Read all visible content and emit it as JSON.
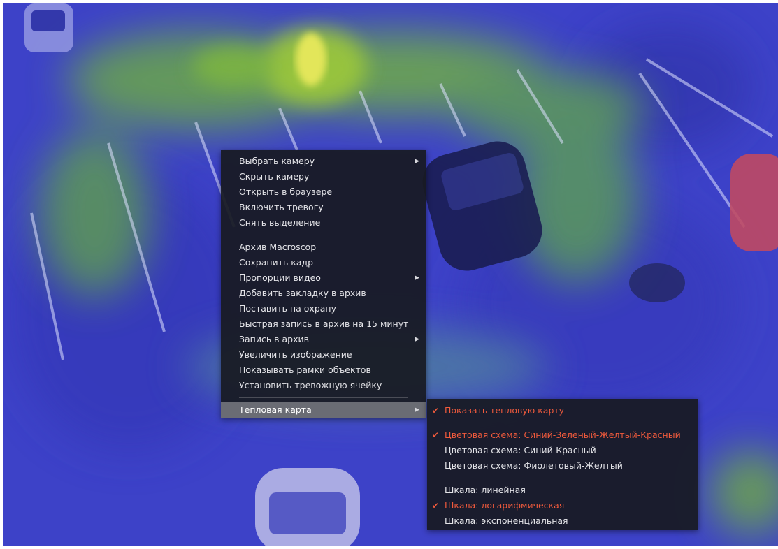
{
  "main_menu": {
    "groups": [
      [
        {
          "label": "Выбрать камеру",
          "submenu": true
        },
        {
          "label": "Скрыть камеру",
          "submenu": false
        },
        {
          "label": "Открыть в браузере",
          "submenu": false
        },
        {
          "label": "Включить тревогу",
          "submenu": false
        },
        {
          "label": "Снять выделение",
          "submenu": false
        }
      ],
      [
        {
          "label": "Архив Macroscop",
          "submenu": false
        },
        {
          "label": "Сохранить кадр",
          "submenu": false
        },
        {
          "label": "Пропорции видео",
          "submenu": true
        },
        {
          "label": "Добавить закладку в архив",
          "submenu": false
        },
        {
          "label": "Поставить на охрану",
          "submenu": false
        },
        {
          "label": "Быстрая запись в архив на 15 минут",
          "submenu": false
        },
        {
          "label": "Запись в архив",
          "submenu": true
        },
        {
          "label": "Увеличить изображение",
          "submenu": false
        },
        {
          "label": "Показывать рамки объектов",
          "submenu": false
        },
        {
          "label": "Установить тревожную ячейку",
          "submenu": false
        }
      ],
      [
        {
          "label": "Тепловая карта",
          "submenu": true,
          "active": true
        }
      ]
    ]
  },
  "heatmap_submenu": {
    "groups": [
      [
        {
          "label": "Показать тепловую карту",
          "checked": true
        }
      ],
      [
        {
          "label": "Цветовая схема: Синий-Зеленый-Желтый-Красный",
          "checked": true
        },
        {
          "label": "Цветовая схема: Синий-Красный",
          "checked": false
        },
        {
          "label": "Цветовая схема: Фиолетовый-Желтый",
          "checked": false
        }
      ],
      [
        {
          "label": "Шкала: линейная",
          "checked": false
        },
        {
          "label": "Шкала: логарифмическая",
          "checked": true
        },
        {
          "label": "Шкала: экспоненциальная",
          "checked": false
        }
      ]
    ]
  },
  "colors": {
    "heatmap_base": "#3c41c9",
    "heatmap_green": "#7fbf3a",
    "heatmap_yellow": "#e8e84a",
    "menu_bg": "#181a21",
    "menu_text": "#e4e4e8",
    "checked_text": "#ef5a3c",
    "active_item_bg": "#6a6c74"
  },
  "icons": {
    "submenu_arrow": "▶",
    "check": "✔"
  }
}
